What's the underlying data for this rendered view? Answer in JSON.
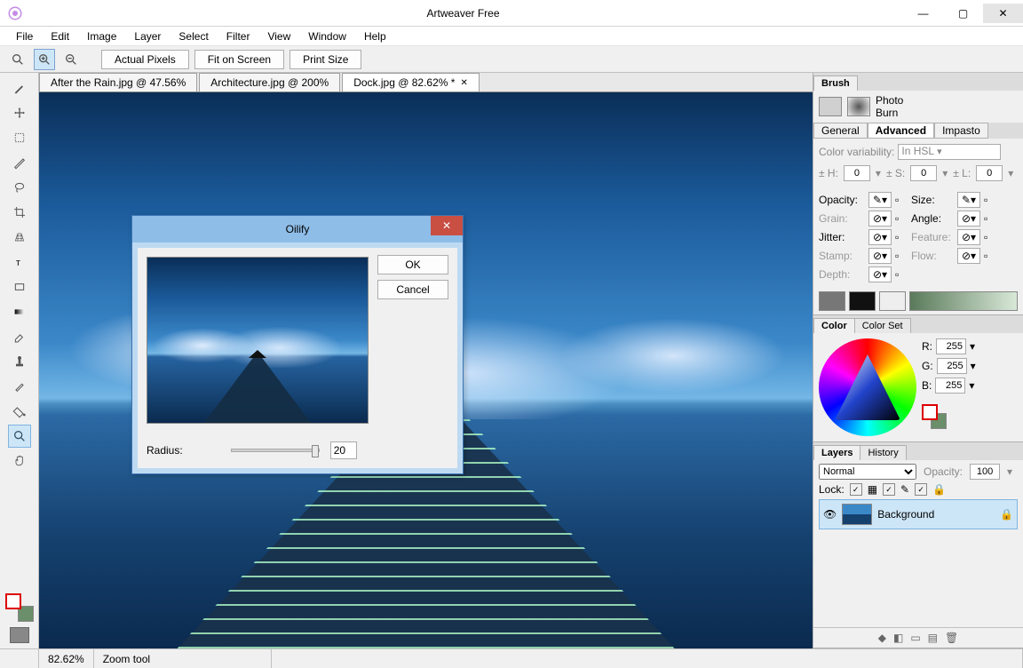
{
  "window": {
    "title": "Artweaver Free",
    "minimize": "—",
    "maximize": "▢",
    "close": "✕"
  },
  "menu": [
    "File",
    "Edit",
    "Image",
    "Layer",
    "Select",
    "Filter",
    "View",
    "Window",
    "Help"
  ],
  "toolbar": {
    "actual_pixels": "Actual Pixels",
    "fit_on_screen": "Fit on Screen",
    "print_size": "Print Size"
  },
  "doc_tabs": [
    {
      "label": "After the Rain.jpg @ 47.56%",
      "active": false
    },
    {
      "label": "Architecture.jpg @ 200%",
      "active": false
    },
    {
      "label": "Dock.jpg @ 82.62% *",
      "active": true
    }
  ],
  "dialog": {
    "title": "Oilify",
    "ok": "OK",
    "cancel": "Cancel",
    "radius_label": "Radius:",
    "radius_value": "20"
  },
  "brush_panel": {
    "tab": "Brush",
    "line1": "Photo",
    "line2": "Burn",
    "subtabs": [
      "General",
      "Advanced",
      "Impasto"
    ],
    "color_var_label": "Color variability:",
    "color_var_value": "In HSL",
    "hsl": {
      "h_label": "± H:",
      "h": "0",
      "s_label": "± S:",
      "s": "0",
      "l_label": "± L:",
      "l": "0"
    },
    "props": {
      "opacity": "Opacity:",
      "size": "Size:",
      "grain": "Grain:",
      "angle": "Angle:",
      "jitter": "Jitter:",
      "feature": "Feature:",
      "stamp": "Stamp:",
      "flow": "Flow:",
      "depth": "Depth:"
    }
  },
  "color_panel": {
    "tabs": [
      "Color",
      "Color Set"
    ],
    "r_label": "R:",
    "g_label": "G:",
    "b_label": "B:",
    "r": "255",
    "g": "255",
    "b": "255"
  },
  "layers_panel": {
    "tabs": [
      "Layers",
      "History"
    ],
    "blend": "Normal",
    "opacity_label": "Opacity:",
    "opacity": "100",
    "lock_label": "Lock:",
    "layer_name": "Background"
  },
  "statusbar": {
    "zoom": "82.62%",
    "tool": "Zoom tool"
  }
}
